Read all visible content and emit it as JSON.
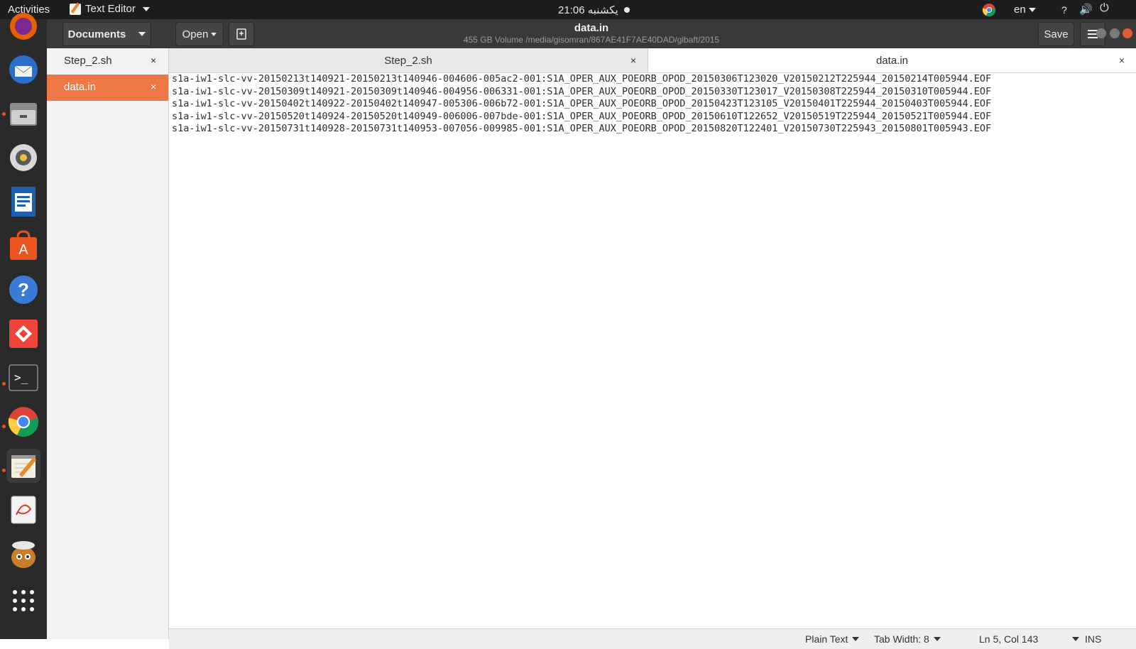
{
  "topbar": {
    "activities": "Activities",
    "app_menu_label": "Text Editor",
    "clock": "21:06 یکشنبه",
    "lang": "en",
    "help": "?"
  },
  "dock": {
    "items": [
      {
        "name": "firefox-icon"
      },
      {
        "name": "thunderbird-icon"
      },
      {
        "name": "files-icon"
      },
      {
        "name": "rhythmbox-icon"
      },
      {
        "name": "libreoffice-writer-icon"
      },
      {
        "name": "software-center-icon"
      },
      {
        "name": "help-icon"
      },
      {
        "name": "anydesk-icon"
      },
      {
        "name": "terminal-icon"
      },
      {
        "name": "chrome-icon"
      },
      {
        "name": "text-editor-icon"
      },
      {
        "name": "document-viewer-icon"
      },
      {
        "name": "gimp-icon"
      },
      {
        "name": "app-grid-icon"
      }
    ]
  },
  "window": {
    "documents_label": "Documents",
    "open_label": "Open",
    "save_label": "Save",
    "title": "data.in",
    "subtitle": "455 GB Volume /media/gisomran/867AE41F7AE40DAD/glbaft/2015"
  },
  "doclist": [
    {
      "label": "Step_2.sh",
      "close": "×",
      "selected": false
    },
    {
      "label": "data.in",
      "close": "×",
      "selected": true
    }
  ],
  "tabs": [
    {
      "label": "Step_2.sh",
      "close": "×"
    },
    {
      "label": "data.in",
      "close": "×"
    }
  ],
  "editor": {
    "lines": [
      "s1a-iw1-slc-vv-20150213t140921-20150213t140946-004606-005ac2-001:S1A_OPER_AUX_POEORB_OPOD_20150306T123020_V20150212T225944_20150214T005944.EOF",
      "s1a-iw1-slc-vv-20150309t140921-20150309t140946-004956-006331-001:S1A_OPER_AUX_POEORB_OPOD_20150330T123017_V20150308T225944_20150310T005944.EOF",
      "s1a-iw1-slc-vv-20150402t140922-20150402t140947-005306-006b72-001:S1A_OPER_AUX_POEORB_OPOD_20150423T123105_V20150401T225944_20150403T005944.EOF",
      "s1a-iw1-slc-vv-20150520t140924-20150520t140949-006006-007bde-001:S1A_OPER_AUX_POEORB_OPOD_20150610T122652_V20150519T225944_20150521T005944.EOF",
      "s1a-iw1-slc-vv-20150731t140928-20150731t140953-007056-009985-001:S1A_OPER_AUX_POEORB_OPOD_20150820T122401_V20150730T225943_20150801T005943.EOF"
    ]
  },
  "statusbar": {
    "language": "Plain Text",
    "tab_width": "Tab Width: 8",
    "position": "Ln 5, Col 143",
    "mode": "INS"
  },
  "colors": {
    "accent": "#f07746",
    "topbar_bg": "#1d1d1d",
    "dock_bg": "#2a2a2a",
    "headerbar_bg": "#393939"
  }
}
